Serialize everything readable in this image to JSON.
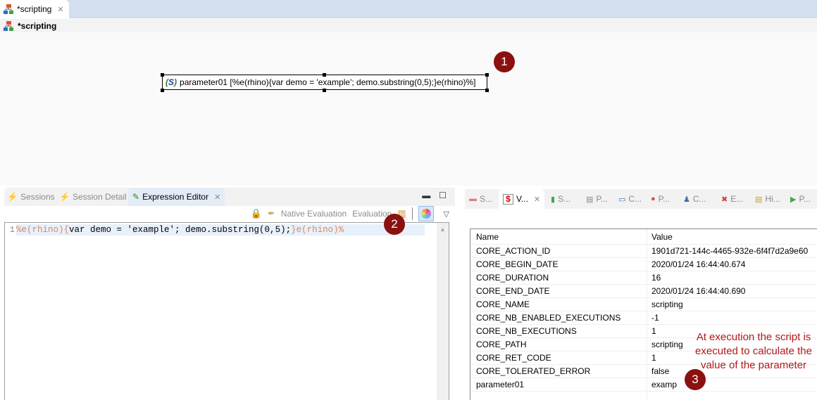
{
  "editor": {
    "tab_label": "*scripting",
    "header_title": "*scripting",
    "node_label": "parameter01 [%e(rhino){var demo = 'example'; demo.substring(0,5);}e(rhino)%]",
    "node_icon": "scripting-variable-icon"
  },
  "badges": {
    "one": "1",
    "two": "2",
    "three": "3"
  },
  "left_panel": {
    "tabs": [
      {
        "label": "Sessions",
        "icon": "lightning-icon",
        "active": false
      },
      {
        "label": "Session Detail",
        "icon": "session-detail-icon",
        "active": false
      },
      {
        "label": "Expression Editor",
        "icon": "expression-editor-icon",
        "active": true
      }
    ],
    "toolbar": {
      "native_evaluation": "Native Evaluation",
      "evaluation": "Evaluation"
    },
    "code": {
      "line_number": "1",
      "tag_open": "%e(rhino){",
      "body": "var demo = 'example'; demo.substring(0,5);",
      "tag_close": "}e(rhino)%"
    }
  },
  "right_panel": {
    "tabs": [
      {
        "label": "S...",
        "icon": "steps-icon",
        "active": false
      },
      {
        "label": "V...",
        "icon": "variables-icon",
        "active": true
      },
      {
        "label": "S...",
        "icon": "statistics-icon",
        "active": false
      },
      {
        "label": "P...",
        "icon": "properties-icon",
        "active": false
      },
      {
        "label": "C...",
        "icon": "console-icon",
        "active": false
      },
      {
        "label": "P...",
        "icon": "privileges-icon",
        "active": false
      },
      {
        "label": "C...",
        "icon": "connections-icon",
        "active": false
      },
      {
        "label": "E...",
        "icon": "errors-icon",
        "active": false
      },
      {
        "label": "Hi...",
        "icon": "history-icon",
        "active": false
      },
      {
        "label": "P...",
        "icon": "progress-icon",
        "active": false
      }
    ],
    "table": {
      "columns": [
        "Name",
        "Value"
      ],
      "rows": [
        [
          "CORE_ACTION_ID",
          "1901d721-144c-4465-932e-6f4f7d2a9e60"
        ],
        [
          "CORE_BEGIN_DATE",
          "2020/01/24 16:44:40.674"
        ],
        [
          "CORE_DURATION",
          "16"
        ],
        [
          "CORE_END_DATE",
          "2020/01/24 16:44:40.690"
        ],
        [
          "CORE_NAME",
          "scripting"
        ],
        [
          "CORE_NB_ENABLED_EXECUTIONS",
          "-1"
        ],
        [
          "CORE_NB_EXECUTIONS",
          "1"
        ],
        [
          "CORE_PATH",
          "scripting"
        ],
        [
          "CORE_RET_CODE",
          "1"
        ],
        [
          "CORE_TOLERATED_ERROR",
          "false"
        ],
        [
          "parameter01",
          "examp"
        ]
      ]
    }
  },
  "annotation": "At execution the script is executed to calculate the value of the parameter",
  "colors": {
    "badge": "#8b1010",
    "annotation": "#b01a1a",
    "code_tag": "#e0875a"
  }
}
